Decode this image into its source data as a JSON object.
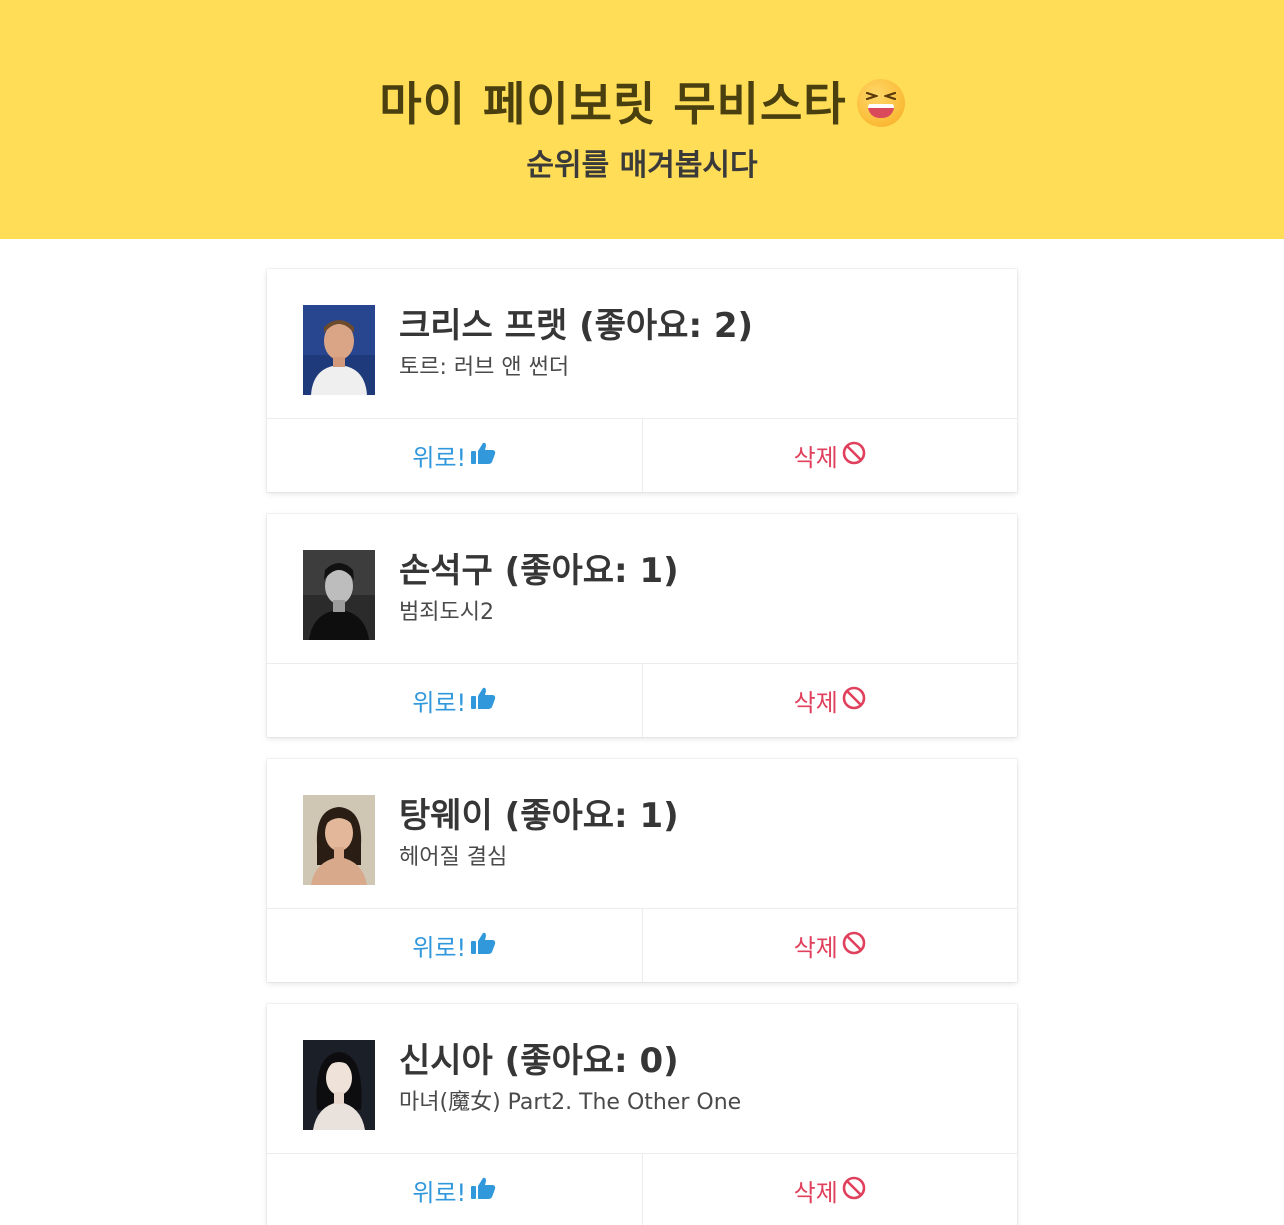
{
  "header": {
    "title": "마이 페이보릿 무비스타",
    "subtitle": "순위를 매겨봅시다",
    "emoji_icon": "grinning-squinting-face"
  },
  "colors": {
    "hero_bg": "#ffdd57",
    "like": "#3298dc",
    "delete": "#e0405c"
  },
  "stars": [
    {
      "name_line": "크리스 프랫 (좋아요: 2)",
      "movie": "토르: 러브 앤 썬더",
      "like_label": "위로!",
      "delete_label": "삭제"
    },
    {
      "name_line": "손석구 (좋아요: 1)",
      "movie": "범죄도시2",
      "like_label": "위로!",
      "delete_label": "삭제"
    },
    {
      "name_line": "탕웨이 (좋아요: 1)",
      "movie": "헤어질 결심",
      "like_label": "위로!",
      "delete_label": "삭제"
    },
    {
      "name_line": "신시아 (좋아요: 0)",
      "movie": "마녀(魔女) Part2. The Other One",
      "like_label": "위로!",
      "delete_label": "삭제"
    }
  ],
  "icons": {
    "like": "thumbs-up-icon",
    "delete": "ban-icon"
  }
}
